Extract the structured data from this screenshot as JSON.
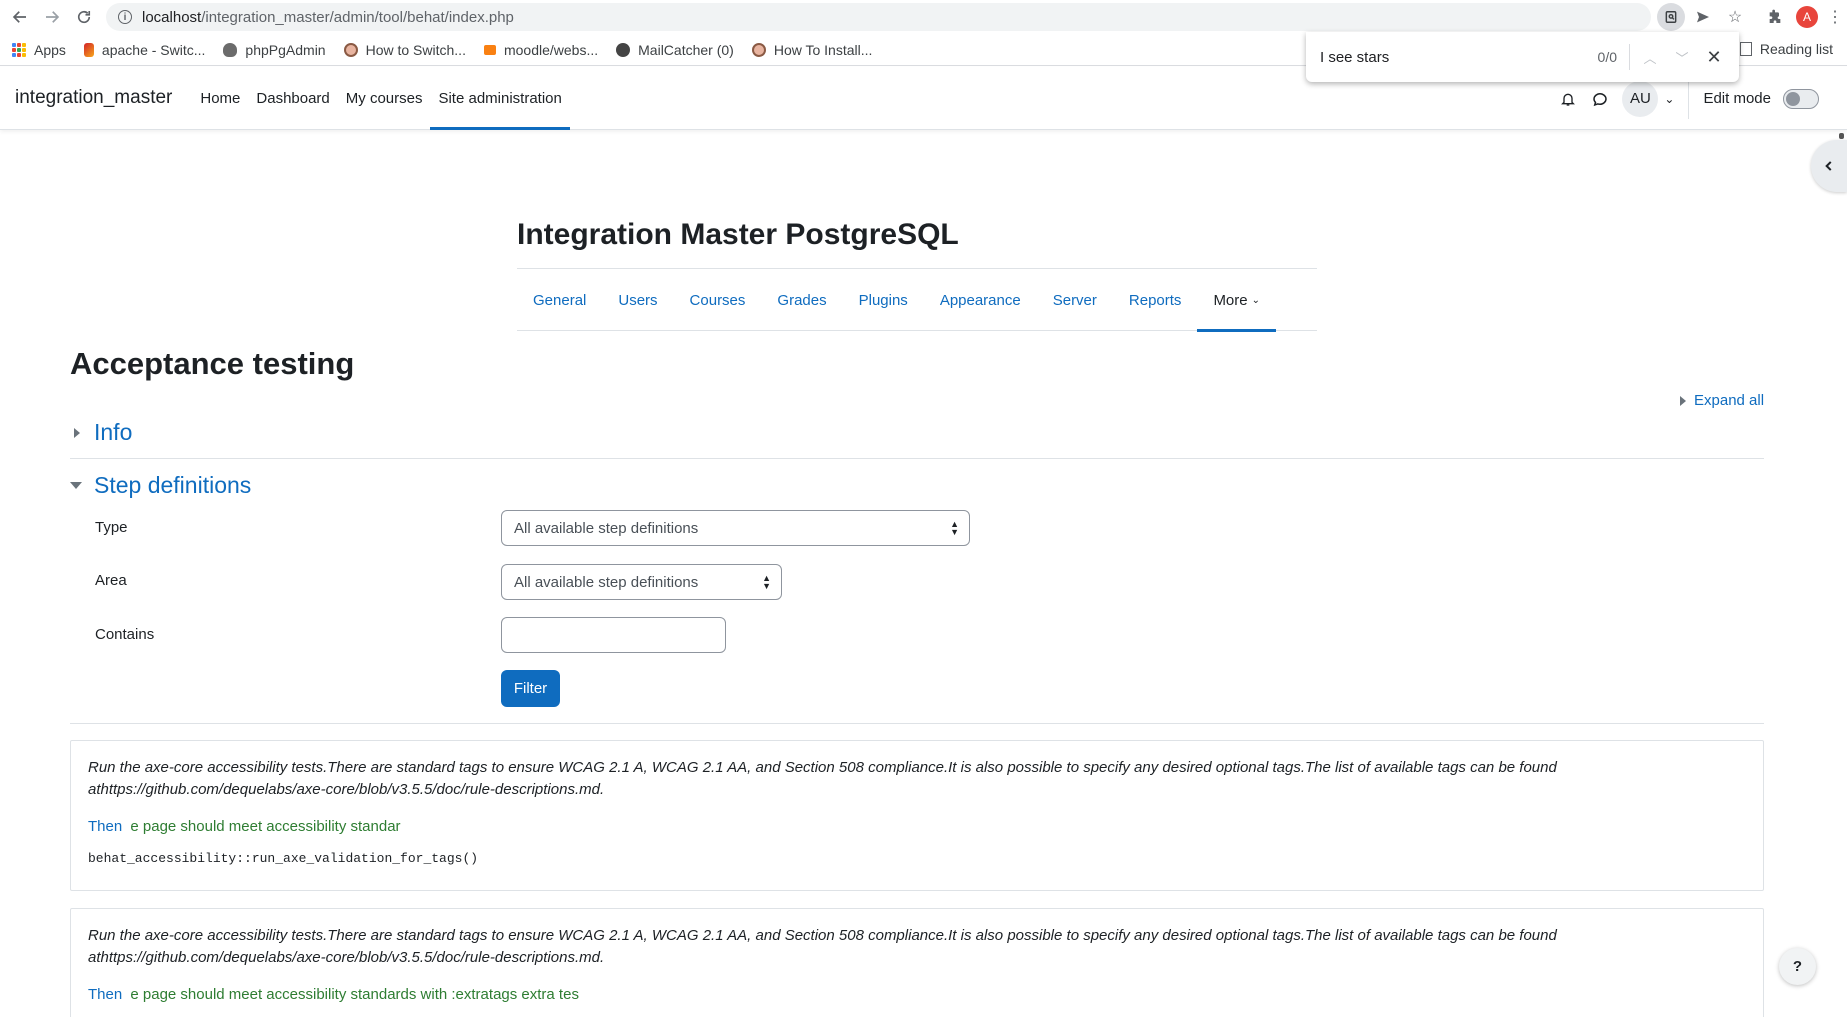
{
  "browser": {
    "url_host": "localhost",
    "url_path": "/integration_master/admin/tool/behat/index.php",
    "bookmarks": [
      "Apps",
      "apache - Switc...",
      "phpPgAdmin",
      "How to Switch...",
      "moodle/webs...",
      "MailCatcher (0)",
      "How To Install..."
    ],
    "reading_list": "Reading list",
    "profile_initial": "A"
  },
  "findbar": {
    "query": "I see stars",
    "count": "0/0"
  },
  "navbar": {
    "site_name": "integration_master",
    "items": [
      "Home",
      "Dashboard",
      "My courses",
      "Site administration"
    ],
    "active_index": 3,
    "avatar": "AU",
    "edit_mode": "Edit mode"
  },
  "page": {
    "title": "Integration Master PostgreSQL",
    "secondary_nav": [
      "General",
      "Users",
      "Courses",
      "Grades",
      "Plugins",
      "Appearance",
      "Server",
      "Reports",
      "More"
    ],
    "heading": "Acceptance testing",
    "expand_all": "Expand all"
  },
  "sections": {
    "info": "Info",
    "step_definitions": "Step definitions"
  },
  "form": {
    "type_label": "Type",
    "type_value": "All available step definitions",
    "area_label": "Area",
    "area_value": "All available step definitions",
    "contains_label": "Contains",
    "contains_value": "",
    "filter_button": "Filter"
  },
  "steps": [
    {
      "description": "Run the axe-core accessibility tests.There are standard tags to ensure WCAG 2.1 A, WCAG 2.1 AA, and Section 508 compliance.It is also possible to specify any desired optional tags.The list of available tags can be found athttps://github.com/dequelabs/axe-core/blob/v3.5.5/doc/rule-descriptions.md.",
      "keyword": "Then",
      "text": "e page should meet accessibility standar",
      "method": "behat_accessibility::run_axe_validation_for_tags()"
    },
    {
      "description": "Run the axe-core accessibility tests.There are standard tags to ensure WCAG 2.1 A, WCAG 2.1 AA, and Section 508 compliance.It is also possible to specify any desired optional tags.The list of available tags can be found athttps://github.com/dequelabs/axe-core/blob/v3.5.5/doc/rule-descriptions.md.",
      "keyword": "Then",
      "text": "e page should meet accessibility standards with :extratags extra tes"
    }
  ],
  "help_button": "?"
}
